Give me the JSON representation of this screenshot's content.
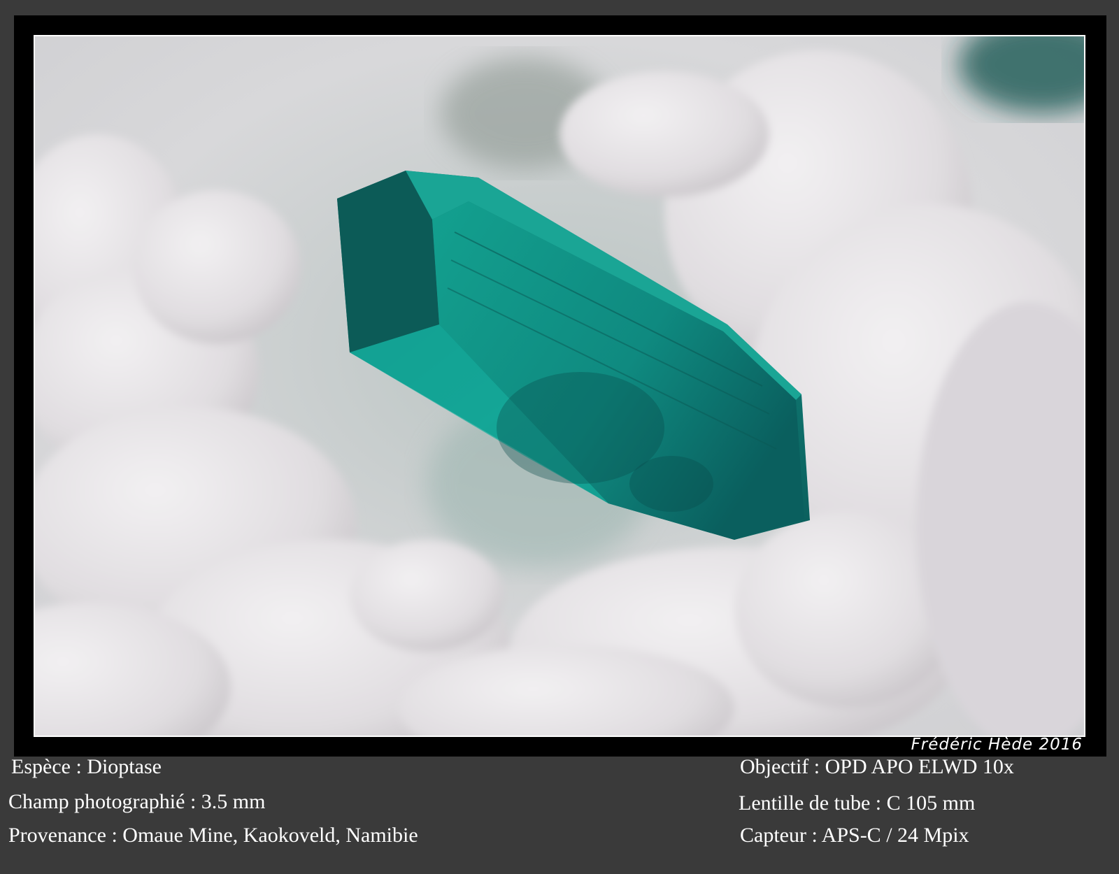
{
  "signature": "Frédéric Hède 2016",
  "left_info": [
    {
      "label": "Espèce",
      "value": "Dioptase"
    },
    {
      "label": "Champ photographié",
      "value": "3.5 mm"
    },
    {
      "label": "Provenance",
      "value": "Omaue Mine, Kaokoveld, Namibie"
    }
  ],
  "right_info": [
    {
      "label": "Objectif",
      "value": "OPD APO ELWD 10x"
    },
    {
      "label": "Lentille de tube",
      "value": "C 105 mm"
    },
    {
      "label": "Capteur",
      "value": "APS-C / 24 Mpix"
    }
  ],
  "colors": {
    "background": "#3a3a3a",
    "frame": "#000000",
    "crystal": "#0f8f84",
    "matrix": "#e4e0e2"
  }
}
